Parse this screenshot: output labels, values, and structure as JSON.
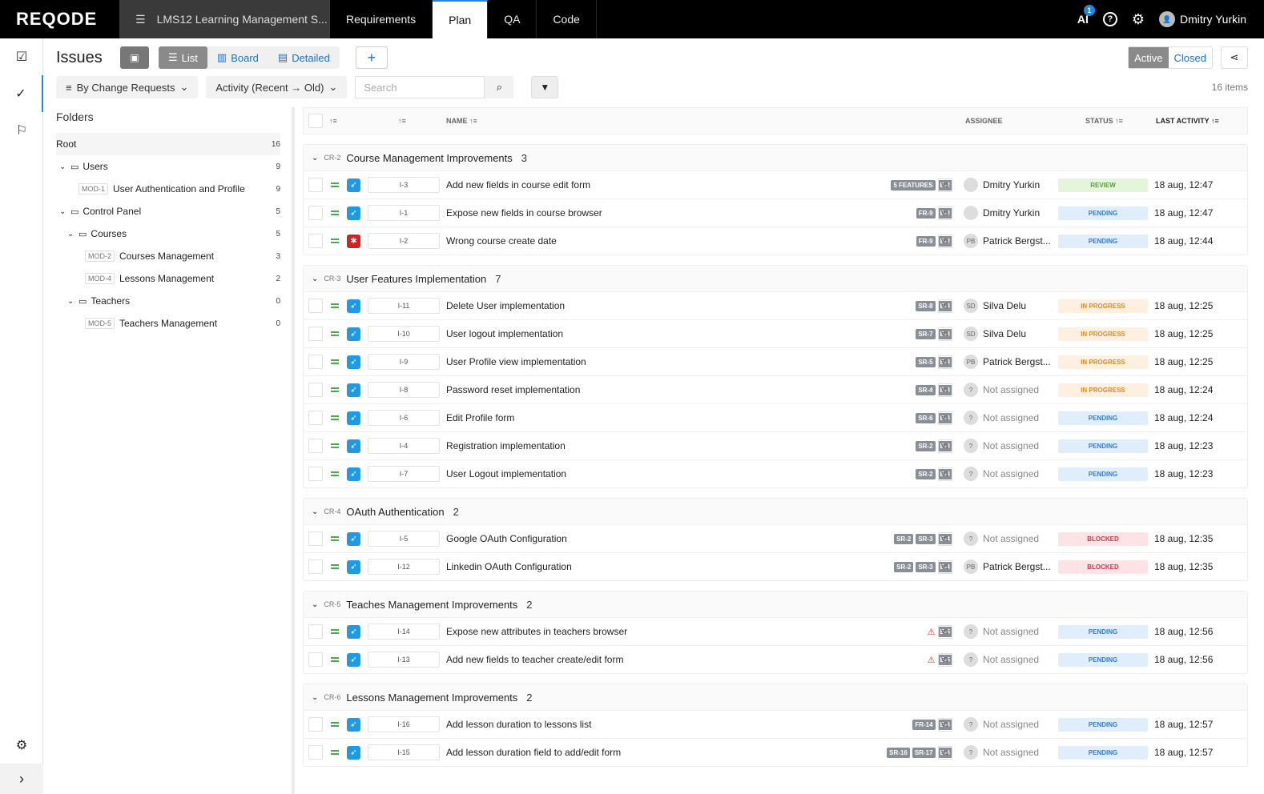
{
  "topbar": {
    "logo": "REQODE",
    "project": "LMS12 Learning Management S...",
    "tabs": [
      "Requirements",
      "Plan",
      "QA",
      "Code"
    ],
    "active_tab": "Plan",
    "ai_label": "AI",
    "ai_badge": "1",
    "help": "?",
    "user_name": "Dmitry Yurkin"
  },
  "toolbar": {
    "title": "Issues",
    "views": [
      "List",
      "Board",
      "Detailed"
    ],
    "active_view": "List",
    "add": "+",
    "segment_active": "Active",
    "segment_closed": "Closed",
    "group_by": "By Change Requests",
    "sort_by": "Activity (Recent → Old)",
    "search_placeholder": "Search",
    "item_count": "16 items"
  },
  "folders": {
    "title": "Folders",
    "items": [
      {
        "label": "Root",
        "count": "16"
      },
      {
        "label": "Users",
        "count": "9"
      },
      {
        "mod": "MOD-1",
        "label": "User Authentication and Profile",
        "count": "9"
      },
      {
        "label": "Control Panel",
        "count": "5"
      },
      {
        "label": "Courses",
        "count": "5"
      },
      {
        "mod": "MOD-2",
        "label": "Courses Management",
        "count": "3"
      },
      {
        "mod": "MOD-4",
        "label": "Lessons Management",
        "count": "2"
      },
      {
        "label": "Teachers",
        "count": "0"
      },
      {
        "mod": "MOD-5",
        "label": "Teachers Management",
        "count": "0"
      }
    ]
  },
  "columns": {
    "name": "NAME",
    "assignee": "ASSIGNEE",
    "status": "STATUS",
    "last_activity": "LAST ACTIVITY"
  },
  "groups": [
    {
      "cr": "CR-2",
      "name": "Course Management Improvements",
      "count": "3",
      "rows": [
        {
          "id": "I-3",
          "type": "feature",
          "name": "Add new fields in course edit form",
          "tags": [
            "5 FEATURES",
            "E-2"
          ],
          "ver": "V1",
          "initials": "",
          "assignee": "Dmitry Yurkin",
          "status": "REVIEW",
          "st": "review",
          "activity": "18 aug, 12:47"
        },
        {
          "id": "I-1",
          "type": "feature",
          "name": "Expose new fields in course browser",
          "tags": [
            "FR-9",
            "E-2"
          ],
          "ver": "V1",
          "initials": "",
          "assignee": "Dmitry Yurkin",
          "status": "PENDING",
          "st": "pending",
          "activity": "18 aug, 12:47"
        },
        {
          "id": "I-2",
          "type": "bug",
          "name": "Wrong course create date",
          "tags": [
            "FR-9",
            "E-2"
          ],
          "ver": "V1",
          "initials": "PB",
          "assignee": "Patrick Bergst...",
          "status": "PENDING",
          "st": "pending",
          "activity": "18 aug, 12:44"
        }
      ]
    },
    {
      "cr": "CR-3",
      "name": "User Features Implementation",
      "count": "7",
      "rows": [
        {
          "id": "I-11",
          "type": "feature",
          "name": "Delete User implementation",
          "tags": [
            "SR-8",
            "E-3"
          ],
          "ver": "V1",
          "initials": "SD",
          "assignee": "Silva Delu",
          "status": "IN PROGRESS",
          "st": "progress",
          "activity": "18 aug, 12:25"
        },
        {
          "id": "I-10",
          "type": "feature",
          "name": "User logout implementation",
          "tags": [
            "SR-7",
            "E-3"
          ],
          "ver": "V1",
          "initials": "SD",
          "assignee": "Silva Delu",
          "status": "IN PROGRESS",
          "st": "progress",
          "activity": "18 aug, 12:25"
        },
        {
          "id": "I-9",
          "type": "feature",
          "name": "User Profile view implementation",
          "tags": [
            "SR-5",
            "E-3"
          ],
          "ver": "V1",
          "initials": "PB",
          "assignee": "Patrick Bergst...",
          "status": "IN PROGRESS",
          "st": "progress",
          "activity": "18 aug, 12:25"
        },
        {
          "id": "I-8",
          "type": "feature",
          "name": "Password reset implementation",
          "tags": [
            "SR-4",
            "E-3"
          ],
          "ver": "V1",
          "initials": "?",
          "assignee": "Not assigned",
          "status": "IN PROGRESS",
          "st": "progress",
          "activity": "18 aug, 12:24"
        },
        {
          "id": "I-6",
          "type": "feature",
          "name": "Edit Profile form",
          "tags": [
            "SR-6",
            "E-3"
          ],
          "ver": "V1",
          "initials": "?",
          "assignee": "Not assigned",
          "status": "PENDING",
          "st": "pending",
          "activity": "18 aug, 12:24"
        },
        {
          "id": "I-4",
          "type": "feature",
          "name": "Registration implementation",
          "tags": [
            "SR-2",
            "E-3"
          ],
          "ver": "V1",
          "initials": "?",
          "assignee": "Not assigned",
          "status": "PENDING",
          "st": "pending",
          "activity": "18 aug, 12:23"
        },
        {
          "id": "I-7",
          "type": "feature",
          "name": "User Logout implementation",
          "tags": [
            "SR-2",
            "E-3"
          ],
          "ver": "V1",
          "initials": "?",
          "assignee": "Not assigned",
          "status": "PENDING",
          "st": "pending",
          "activity": "18 aug, 12:23"
        }
      ]
    },
    {
      "cr": "CR-4",
      "name": "OAuth Authentication",
      "count": "2",
      "rows": [
        {
          "id": "I-5",
          "type": "feature",
          "name": "Google OAuth Configuration",
          "tags": [
            "SR-2",
            "SR-3",
            "E-4"
          ],
          "ver": "V1",
          "initials": "?",
          "assignee": "Not assigned",
          "status": "BLOCKED",
          "st": "blocked",
          "activity": "18 aug, 12:35"
        },
        {
          "id": "I-12",
          "type": "feature",
          "name": "Linkedin OAuth Configuration",
          "tags": [
            "SR-2",
            "SR-3",
            "E-4"
          ],
          "ver": "V1",
          "initials": "PB",
          "assignee": "Patrick Bergst...",
          "status": "BLOCKED",
          "st": "blocked",
          "activity": "18 aug, 12:35"
        }
      ]
    },
    {
      "cr": "CR-5",
      "name": "Teaches Management Improvements",
      "count": "2",
      "rows": [
        {
          "id": "I-14",
          "type": "feature",
          "name": "Expose new attributes in teachers browser",
          "tags": [
            "!",
            "E-5"
          ],
          "ver": "V1",
          "initials": "?",
          "assignee": "Not assigned",
          "status": "PENDING",
          "st": "pending",
          "activity": "18 aug, 12:56"
        },
        {
          "id": "I-13",
          "type": "feature",
          "name": "Add new fields to teacher create/edit form",
          "tags": [
            "!",
            "E-5"
          ],
          "ver": "V1",
          "initials": "?",
          "assignee": "Not assigned",
          "status": "PENDING",
          "st": "pending",
          "activity": "18 aug, 12:56"
        }
      ]
    },
    {
      "cr": "CR-6",
      "name": "Lessons Management Improvements",
      "count": "2",
      "rows": [
        {
          "id": "I-16",
          "type": "feature",
          "name": "Add lesson duration to lessons list",
          "tags": [
            "FR-14",
            "E-6"
          ],
          "ver": "V1",
          "initials": "?",
          "assignee": "Not assigned",
          "status": "PENDING",
          "st": "pending",
          "activity": "18 aug, 12:57"
        },
        {
          "id": "I-15",
          "type": "feature",
          "name": "Add lesson duration field to add/edit form",
          "tags": [
            "SR-16",
            "SR-17",
            "E-6"
          ],
          "ver": "V1",
          "initials": "?",
          "assignee": "Not assigned",
          "status": "PENDING",
          "st": "pending",
          "activity": "18 aug, 12:57"
        }
      ]
    }
  ]
}
